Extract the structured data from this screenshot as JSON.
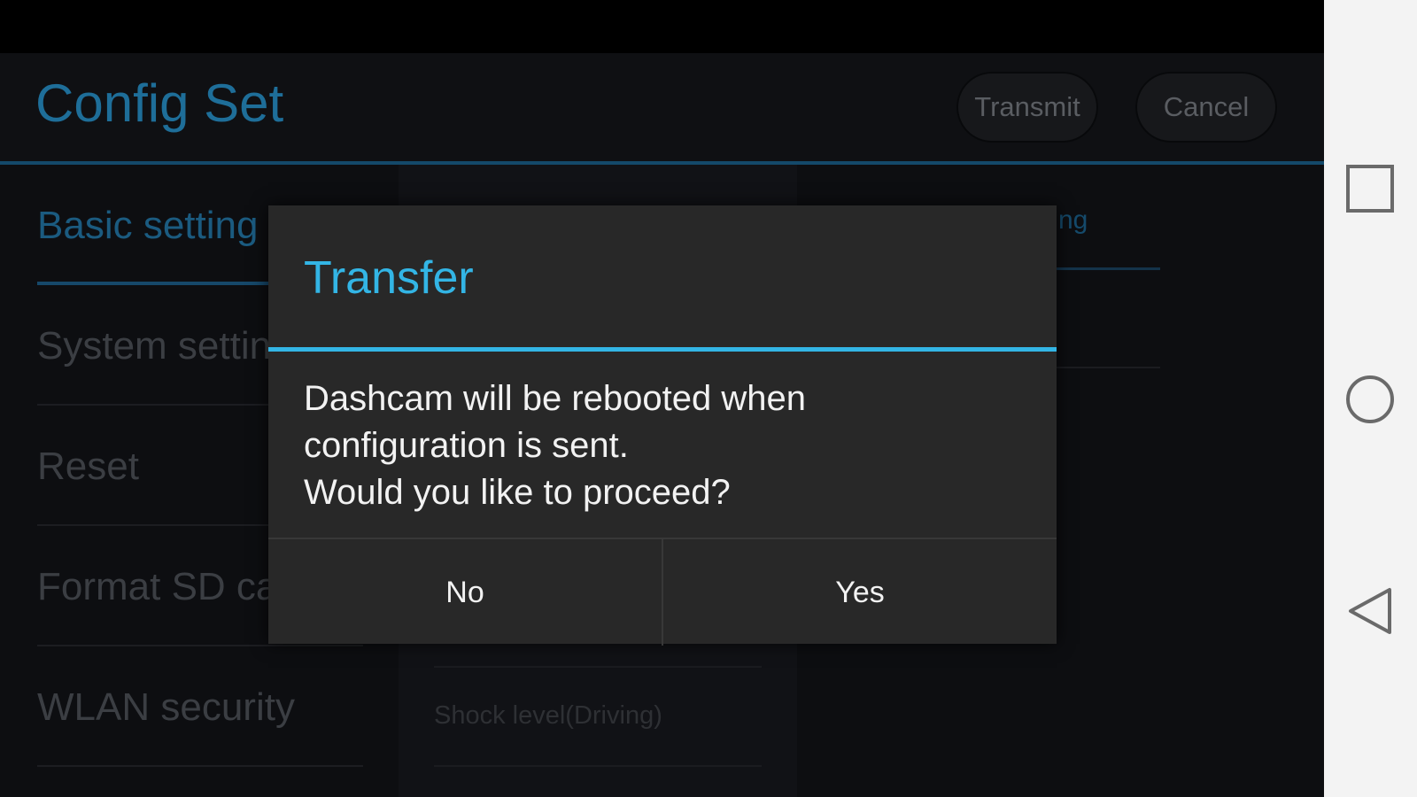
{
  "app": {
    "title": "Config Set",
    "transmit_label": "Transmit",
    "cancel_label": "Cancel"
  },
  "menu": {
    "items": [
      {
        "label": "Basic setting",
        "active": true
      },
      {
        "label": "System setting",
        "active": false
      },
      {
        "label": "Reset",
        "active": false
      },
      {
        "label": "Format SD card",
        "active": false
      },
      {
        "label": "WLAN security",
        "active": false
      }
    ]
  },
  "middle": {
    "item": "Shock level(Driving)"
  },
  "right": {
    "label_partial": "ng"
  },
  "dialog": {
    "title": "Transfer",
    "message_lines": [
      "Dashcam will be rebooted when",
      "configuration is sent.",
      "Would you like to proceed?"
    ],
    "no_label": "No",
    "yes_label": "Yes"
  },
  "nav": {
    "icons": [
      "recents-square-icon",
      "home-circle-icon",
      "back-triangle-icon"
    ]
  },
  "colors": {
    "accent": "#33b5e5",
    "dialog_bg": "#282828",
    "nav_bg": "#f3f3f3"
  }
}
